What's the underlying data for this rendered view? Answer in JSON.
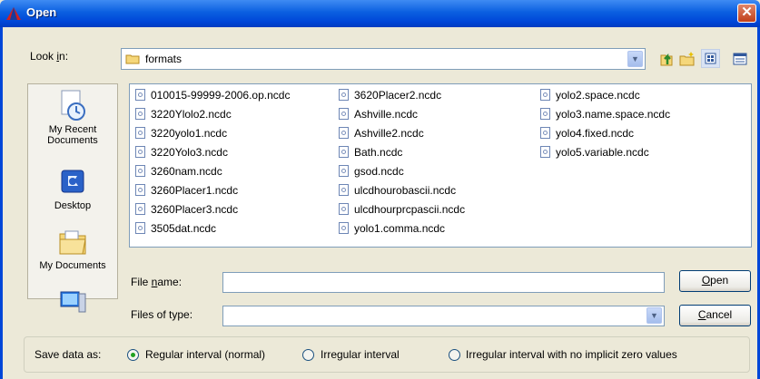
{
  "window": {
    "title": "Open",
    "close_glyph": "✕"
  },
  "lookin": {
    "label_pre": "Look ",
    "label_key": "i",
    "label_post": "n:",
    "value": "formats"
  },
  "places": [
    {
      "name": "My Recent Documents",
      "line1": "My Recent",
      "line2": "Documents",
      "icon": "recent-documents-icon"
    },
    {
      "name": "Desktop",
      "line1": "Desktop",
      "line2": "",
      "icon": "desktop-icon"
    },
    {
      "name": "My Documents",
      "line1": "My Documents",
      "line2": "",
      "icon": "my-documents-icon"
    },
    {
      "name": "My Computer",
      "line1": "",
      "line2": "",
      "icon": "my-computer-icon"
    }
  ],
  "files": [
    [
      "010015-99999-2006.op.ncdc",
      "3220Ylolo2.ncdc",
      "3220yolo1.ncdc",
      "3220Yolo3.ncdc",
      "3260nam.ncdc",
      "3260Placer1.ncdc",
      "3260Placer3.ncdc",
      "3505dat.ncdc"
    ],
    [
      "3620Placer2.ncdc",
      "Ashville.ncdc",
      "Ashville2.ncdc",
      "Bath.ncdc",
      "gsod.ncdc",
      "ulcdhourobascii.ncdc",
      "ulcdhourprcpascii.ncdc",
      "yolo1.comma.ncdc"
    ],
    [
      "yolo2.space.ncdc",
      "yolo3.name.space.ncdc",
      "yolo4.fixed.ncdc",
      "yolo5.variable.ncdc"
    ]
  ],
  "filename": {
    "label_pre": "File ",
    "label_key": "n",
    "label_post": "ame:",
    "value": ""
  },
  "filetype": {
    "label": "Files of type:",
    "value": ""
  },
  "buttons": {
    "open_key": "O",
    "open_rest": "pen",
    "cancel_key": "C",
    "cancel_rest": "ancel"
  },
  "save": {
    "label": "Save data as:",
    "options": [
      {
        "label": "Regular interval (normal)",
        "checked": true
      },
      {
        "label": "Irregular interval",
        "checked": false
      },
      {
        "label": "Irregular interval with no implicit zero values",
        "checked": false
      }
    ]
  },
  "colors": {
    "titlebar": "#0a5fe0",
    "dialog_bg": "#ece9d8",
    "accent": "#0046d8"
  }
}
